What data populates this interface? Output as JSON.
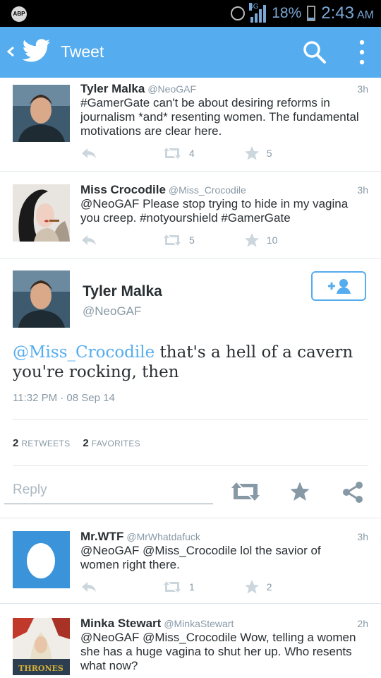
{
  "status_bar": {
    "adblock_label": "ABP",
    "network": "4G",
    "battery": "18%",
    "time": "2:43",
    "ampm": "AM"
  },
  "app_bar": {
    "title": "Tweet",
    "background": "#55acee"
  },
  "tweets_above": [
    {
      "name": "Tyler Malka",
      "handle": "@NeoGAF",
      "time": "3h",
      "text": "#GamerGate can't be about desiring reforms in journalism *and* resenting women. The fundamental motivations are clear here.",
      "retweets": "4",
      "favorites": "5"
    },
    {
      "name": "Miss Crocodile",
      "handle": "@Miss_Crocodile",
      "time": "3h",
      "text": "@NeoGAF Please stop trying to hide in my vagina you creep. #notyourshield #GamerGate",
      "retweets": "5",
      "favorites": "10"
    }
  ],
  "main_tweet": {
    "name": "Tyler Malka",
    "handle": "@NeoGAF",
    "mention": "@Miss_Crocodile",
    "text": " that's a hell of a cavern you're rocking, then",
    "timestamp": "11:32 PM · 08 Sep 14",
    "retweets_count": "2",
    "retweets_label": "RETWEETS",
    "favorites_count": "2",
    "favorites_label": "FAVORITES",
    "reply_placeholder": "Reply"
  },
  "tweets_below": [
    {
      "name": "Mr.WTF",
      "handle": "@MrWhatdafuck",
      "time": "3h",
      "text": "@NeoGAF @Miss_Crocodile lol the savior of women right there.",
      "retweets": "1",
      "favorites": "2"
    },
    {
      "name": "Minka Stewart",
      "handle": "@MinkaStewart",
      "time": "2h",
      "text": "@NeoGAF @Miss_Crocodile Wow, telling a women she has a huge vagina to shut her up. Who resents what now?",
      "avatar_text": "THRONES"
    }
  ],
  "colors": {
    "accent": "#55acee",
    "text": "#292f33",
    "muted": "#8899a6",
    "divider": "#e1e8ed"
  }
}
